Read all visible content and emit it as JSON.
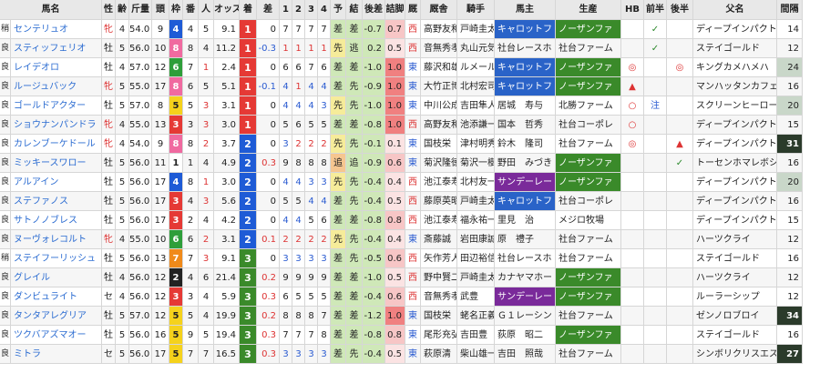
{
  "headers": [
    "馬名",
    "性",
    "齢",
    "斤量",
    "頭",
    "枠",
    "番",
    "人",
    "オッズ",
    "着",
    "差",
    "1",
    "2",
    "3",
    "4",
    "予",
    "結",
    "後差",
    "詰脚",
    "厩",
    "厩舎",
    "騎手",
    "馬主",
    "生産",
    "HB",
    "前半",
    "後半",
    "父名",
    "間隔"
  ],
  "waku_colors": {
    "1": "#ffffff",
    "2": "#222222",
    "3": "#e53935",
    "4": "#1e5bd6",
    "5": "#f5d21c",
    "6": "#2e9e3a",
    "7": "#f08a1a",
    "8": "#f06aa0"
  },
  "rank_colors": {
    "1": "#e53935",
    "2": "#1e5bd6",
    "3": "#3a8a2a"
  },
  "rows": [
    {
      "cond": "稍",
      "name": "センテリュオ",
      "sex": "牝",
      "age": "4",
      "kin": "54.0",
      "to": "9",
      "waku": "4",
      "ban": "4",
      "nin": "5",
      "odds": "9.1",
      "chaku": "1",
      "sa": "0",
      "p1": "7",
      "p2": "7",
      "p3": "7",
      "p4": "7",
      "yo": "差",
      "ke": "差",
      "kosa": "-0.7",
      "tsume": "0.7",
      "kyu": "西",
      "kyusha": "高野友和",
      "kishu": "戸崎圭太",
      "owner": "キャロットフ",
      "farm": "ノーザンファ",
      "hb": "",
      "zen": "✓",
      "kou": "",
      "sire": "ディープインパクト",
      "kan": "14"
    },
    {
      "cond": "良",
      "name": "スティッフェリオ",
      "sex": "牡",
      "age": "5",
      "kin": "56.0",
      "to": "10",
      "waku": "8",
      "ban": "8",
      "nin": "4",
      "odds": "11.2",
      "chaku": "1",
      "sa": "-0.3",
      "p1": "1",
      "p2": "1",
      "p3": "1",
      "p4": "1",
      "yo": "先",
      "ke": "逃",
      "kosa": "0.2",
      "tsume": "0.5",
      "kyu": "西",
      "kyusha": "音無秀孝",
      "kishu": "丸山元気",
      "owner": "社台レースホ",
      "farm": "社台ファーム",
      "hb": "",
      "zen": "✓",
      "kou": "",
      "sire": "ステイゴールド",
      "kan": "12"
    },
    {
      "cond": "良",
      "name": "レイデオロ",
      "sex": "牡",
      "age": "4",
      "kin": "57.0",
      "to": "12",
      "waku": "6",
      "ban": "7",
      "nin": "1",
      "odds": "2.4",
      "chaku": "1",
      "sa": "0",
      "p1": "6",
      "p2": "6",
      "p3": "7",
      "p4": "6",
      "yo": "差",
      "ke": "差",
      "kosa": "-1.0",
      "tsume": "1.0",
      "kyu": "東",
      "kyusha": "藤沢和雄",
      "kishu": "ルメール",
      "owner": "キャロットフ",
      "farm": "ノーザンファ",
      "hb": "◎",
      "zen": "",
      "kou": "◎",
      "sire": "キングカメハメハ",
      "kan": "24"
    },
    {
      "cond": "良",
      "name": "ルージュバック",
      "sex": "牝",
      "age": "5",
      "kin": "55.0",
      "to": "17",
      "waku": "8",
      "ban": "6",
      "nin": "5",
      "odds": "5.1",
      "chaku": "1",
      "sa": "-0.1",
      "p1": "4",
      "p2": "1",
      "p3": "4",
      "p4": "4",
      "yo": "差",
      "ke": "先",
      "kosa": "-0.9",
      "tsume": "1.0",
      "kyu": "東",
      "kyusha": "大竹正博",
      "kishu": "北村宏司",
      "owner": "キャロットフ",
      "farm": "ノーザンファ",
      "hb": "▲",
      "zen": "",
      "kou": "",
      "sire": "マンハッタンカフェ",
      "kan": "16"
    },
    {
      "cond": "良",
      "name": "ゴールドアクター",
      "sex": "牡",
      "age": "5",
      "kin": "57.0",
      "to": "8",
      "waku": "5",
      "ban": "5",
      "nin": "3",
      "odds": "3.1",
      "chaku": "1",
      "sa": "0",
      "p1": "4",
      "p2": "4",
      "p3": "4",
      "p4": "3",
      "yo": "先",
      "ke": "先",
      "kosa": "-1.0",
      "tsume": "1.0",
      "kyu": "東",
      "kyusha": "中川公成",
      "kishu": "吉田隼人",
      "owner": "居城　寿与",
      "farm": "北勝ファーム",
      "hb": "○",
      "zen": "注",
      "kou": "",
      "sire": "スクリーンヒーロー",
      "kan": "20"
    },
    {
      "cond": "良",
      "name": "ショウナンパンドラ",
      "sex": "牝",
      "age": "4",
      "kin": "55.0",
      "to": "13",
      "waku": "3",
      "ban": "3",
      "nin": "3",
      "odds": "3.0",
      "chaku": "1",
      "sa": "0",
      "p1": "5",
      "p2": "6",
      "p3": "5",
      "p4": "5",
      "yo": "差",
      "ke": "差",
      "kosa": "-0.8",
      "tsume": "1.0",
      "kyu": "西",
      "kyusha": "高野友和",
      "kishu": "池添謙一",
      "owner": "国本　哲秀",
      "farm": "社台コーポレ",
      "hb": "○",
      "zen": "",
      "kou": "",
      "sire": "ディープインパクト",
      "kan": "15"
    },
    {
      "cond": "良",
      "name": "カレンブーケドール",
      "sex": "牝",
      "age": "4",
      "kin": "54.0",
      "to": "9",
      "waku": "8",
      "ban": "8",
      "nin": "2",
      "odds": "3.7",
      "chaku": "2",
      "sa": "0",
      "p1": "3",
      "p2": "2",
      "p3": "2",
      "p4": "2",
      "yo": "先",
      "ke": "先",
      "kosa": "-0.1",
      "tsume": "0.1",
      "kyu": "東",
      "kyusha": "国枝栄",
      "kishu": "津村明秀",
      "owner": "鈴木　隆司",
      "farm": "社台ファーム",
      "hb": "◎",
      "zen": "",
      "kou": "▲",
      "sire": "ディープインパクト",
      "kan": "31"
    },
    {
      "cond": "良",
      "name": "ミッキースワロー",
      "sex": "牡",
      "age": "5",
      "kin": "56.0",
      "to": "11",
      "waku": "1",
      "ban": "1",
      "nin": "4",
      "odds": "4.9",
      "chaku": "2",
      "sa": "0.3",
      "p1": "9",
      "p2": "8",
      "p3": "8",
      "p4": "8",
      "yo": "追",
      "ke": "追",
      "kosa": "-0.9",
      "tsume": "0.6",
      "kyu": "東",
      "kyusha": "菊沢隆徳",
      "kishu": "菊沢一樹",
      "owner": "野田　みづき",
      "farm": "ノーザンファ",
      "hb": "",
      "zen": "",
      "kou": "✓",
      "sire": "トーセンホマレボシ",
      "kan": "16"
    },
    {
      "cond": "良",
      "name": "アルアイン",
      "sex": "牡",
      "age": "5",
      "kin": "56.0",
      "to": "17",
      "waku": "4",
      "ban": "8",
      "nin": "1",
      "odds": "3.0",
      "chaku": "2",
      "sa": "0",
      "p1": "4",
      "p2": "4",
      "p3": "3",
      "p4": "3",
      "yo": "先",
      "ke": "先",
      "kosa": "-0.4",
      "tsume": "0.4",
      "kyu": "西",
      "kyusha": "池江泰寿",
      "kishu": "北村友一",
      "owner": "サンデーレー",
      "farm": "ノーザンファ",
      "hb": "",
      "zen": "",
      "kou": "",
      "sire": "ディープインパクト",
      "kan": "20"
    },
    {
      "cond": "良",
      "name": "ステファノス",
      "sex": "牡",
      "age": "5",
      "kin": "56.0",
      "to": "17",
      "waku": "3",
      "ban": "4",
      "nin": "3",
      "odds": "5.6",
      "chaku": "2",
      "sa": "0",
      "p1": "5",
      "p2": "5",
      "p3": "4",
      "p4": "4",
      "yo": "差",
      "ke": "先",
      "kosa": "-0.4",
      "tsume": "0.5",
      "kyu": "西",
      "kyusha": "藤原英昭",
      "kishu": "戸崎圭太",
      "owner": "キャロットフ",
      "farm": "社台コーポレ",
      "hb": "",
      "zen": "",
      "kou": "",
      "sire": "ディープインパクト",
      "kan": "16"
    },
    {
      "cond": "良",
      "name": "サトノノブレス",
      "sex": "牡",
      "age": "5",
      "kin": "56.0",
      "to": "17",
      "waku": "3",
      "ban": "2",
      "nin": "4",
      "odds": "4.2",
      "chaku": "2",
      "sa": "0",
      "p1": "4",
      "p2": "4",
      "p3": "5",
      "p4": "6",
      "yo": "差",
      "ke": "差",
      "kosa": "-0.8",
      "tsume": "0.8",
      "kyu": "西",
      "kyusha": "池江泰寿",
      "kishu": "福永祐一",
      "owner": "里見　治",
      "farm": "メジロ牧場",
      "hb": "",
      "zen": "",
      "kou": "",
      "sire": "ディープインパクト",
      "kan": "15"
    },
    {
      "cond": "良",
      "name": "ヌーヴォレコルト",
      "sex": "牝",
      "age": "4",
      "kin": "55.0",
      "to": "10",
      "waku": "6",
      "ban": "6",
      "nin": "2",
      "odds": "3.1",
      "chaku": "2",
      "sa": "0.1",
      "p1": "2",
      "p2": "2",
      "p3": "2",
      "p4": "2",
      "yo": "先",
      "ke": "先",
      "kosa": "-0.4",
      "tsume": "0.4",
      "kyu": "東",
      "kyusha": "斎藤誠",
      "kishu": "岩田康誠",
      "owner": "原　禮子",
      "farm": "社台ファーム",
      "hb": "",
      "zen": "",
      "kou": "",
      "sire": "ハーツクライ",
      "kan": "12"
    },
    {
      "cond": "稍",
      "name": "ステイフーリッシュ",
      "sex": "牡",
      "age": "5",
      "kin": "56.0",
      "to": "13",
      "waku": "7",
      "ban": "7",
      "nin": "3",
      "odds": "9.1",
      "chaku": "3",
      "sa": "0",
      "p1": "3",
      "p2": "3",
      "p3": "3",
      "p4": "3",
      "yo": "差",
      "ke": "先",
      "kosa": "-0.5",
      "tsume": "0.6",
      "kyu": "西",
      "kyusha": "矢作芳人",
      "kishu": "田辺裕信",
      "owner": "社台レースホ",
      "farm": "社台ファーム",
      "hb": "",
      "zen": "",
      "kou": "",
      "sire": "ステイゴールド",
      "kan": "16"
    },
    {
      "cond": "良",
      "name": "グレイル",
      "sex": "牡",
      "age": "4",
      "kin": "56.0",
      "to": "12",
      "waku": "2",
      "ban": "4",
      "nin": "6",
      "odds": "21.4",
      "chaku": "3",
      "sa": "0.2",
      "p1": "9",
      "p2": "9",
      "p3": "9",
      "p4": "9",
      "yo": "差",
      "ke": "差",
      "kosa": "-1.0",
      "tsume": "0.5",
      "kyu": "西",
      "kyusha": "野中賢二",
      "kishu": "戸崎圭太",
      "owner": "カナヤマホー",
      "farm": "ノーザンファ",
      "hb": "",
      "zen": "",
      "kou": "",
      "sire": "ハーツクライ",
      "kan": "12"
    },
    {
      "cond": "良",
      "name": "ダンビュライト",
      "sex": "セ",
      "age": "4",
      "kin": "56.0",
      "to": "12",
      "waku": "3",
      "ban": "3",
      "nin": "4",
      "odds": "5.9",
      "chaku": "3",
      "sa": "0.3",
      "p1": "6",
      "p2": "5",
      "p3": "5",
      "p4": "5",
      "yo": "差",
      "ke": "差",
      "kosa": "-0.4",
      "tsume": "0.6",
      "kyu": "西",
      "kyusha": "音無秀孝",
      "kishu": "武豊",
      "owner": "サンデーレー",
      "farm": "ノーザンファ",
      "hb": "",
      "zen": "",
      "kou": "",
      "sire": "ルーラーシップ",
      "kan": "12"
    },
    {
      "cond": "良",
      "name": "タンタアレグリア",
      "sex": "牡",
      "age": "5",
      "kin": "57.0",
      "to": "12",
      "waku": "5",
      "ban": "5",
      "nin": "4",
      "odds": "19.9",
      "chaku": "3",
      "sa": "0.2",
      "p1": "8",
      "p2": "8",
      "p3": "8",
      "p4": "7",
      "yo": "差",
      "ke": "差",
      "kosa": "-1.2",
      "tsume": "1.0",
      "kyu": "東",
      "kyusha": "国枝栄",
      "kishu": "蛯名正義",
      "owner": "Ｇ１レーシン",
      "farm": "社台ファーム",
      "hb": "",
      "zen": "",
      "kou": "",
      "sire": "ゼンノロブロイ",
      "kan": "34"
    },
    {
      "cond": "良",
      "name": "ツクバアズマオー",
      "sex": "牡",
      "age": "5",
      "kin": "56.0",
      "to": "16",
      "waku": "5",
      "ban": "9",
      "nin": "5",
      "odds": "19.4",
      "chaku": "3",
      "sa": "0.3",
      "p1": "7",
      "p2": "7",
      "p3": "7",
      "p4": "8",
      "yo": "差",
      "ke": "差",
      "kosa": "-0.8",
      "tsume": "0.8",
      "kyu": "東",
      "kyusha": "尾形充弘",
      "kishu": "吉田豊",
      "owner": "荻原　昭二",
      "farm": "ノーザンファ",
      "hb": "",
      "zen": "",
      "kou": "",
      "sire": "ステイゴールド",
      "kan": "16"
    },
    {
      "cond": "良",
      "name": "ミトラ",
      "sex": "セ",
      "age": "5",
      "kin": "56.0",
      "to": "17",
      "waku": "5",
      "ban": "7",
      "nin": "7",
      "odds": "16.5",
      "chaku": "3",
      "sa": "0.3",
      "p1": "3",
      "p2": "3",
      "p3": "3",
      "p4": "3",
      "yo": "差",
      "ke": "先",
      "kosa": "-0.4",
      "tsume": "0.5",
      "kyu": "東",
      "kyusha": "萩原清",
      "kishu": "柴山雄一",
      "owner": "吉田　照哉",
      "farm": "社台ファーム",
      "hb": "",
      "zen": "",
      "kou": "",
      "sire": "シンボリクリスエス",
      "kan": "27"
    }
  ]
}
